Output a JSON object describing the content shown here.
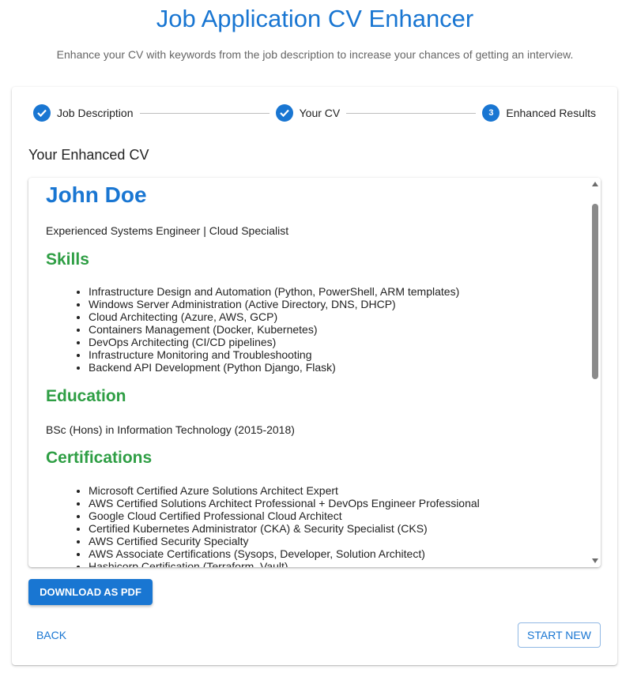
{
  "header": {
    "title": "Job Application CV Enhancer",
    "subtitle": "Enhance your CV with keywords from the job description to increase your chances of getting an interview."
  },
  "stepper": {
    "steps": [
      {
        "label": "Job Description",
        "state": "completed"
      },
      {
        "label": "Your CV",
        "state": "completed"
      },
      {
        "label": "Enhanced Results",
        "state": "active",
        "number": "3"
      }
    ]
  },
  "results": {
    "heading": "Your Enhanced CV"
  },
  "cv": {
    "name": "John Doe",
    "tagline": "Experienced Systems Engineer | Cloud Specialist",
    "skills_heading": "Skills",
    "skills": [
      "Infrastructure Design and Automation (Python, PowerShell, ARM templates)",
      "Windows Server Administration (Active Directory, DNS, DHCP)",
      "Cloud Architecting (Azure, AWS, GCP)",
      "Containers Management (Docker, Kubernetes)",
      "DevOps Architecting (CI/CD pipelines)",
      "Infrastructure Monitoring and Troubleshooting",
      "Backend API Development (Python Django, Flask)"
    ],
    "education_heading": "Education",
    "education": "BSc (Hons) in Information Technology (2015-2018)",
    "certifications_heading": "Certifications",
    "certifications": [
      "Microsoft Certified Azure Solutions Architect Expert",
      "AWS Certified Solutions Architect Professional + DevOps Engineer Professional",
      "Google Cloud Certified Professional Cloud Architect",
      "Certified Kubernetes Administrator (CKA) & Security Specialist (CKS)",
      "AWS Certified Security Specialty",
      "AWS Associate Certifications (Sysops, Developer, Solution Architect)",
      "Hashicorp Certification (Terraform, Vault)"
    ]
  },
  "actions": {
    "download_label": "DOWNLOAD AS PDF",
    "back_label": "BACK",
    "start_new_label": "START NEW"
  },
  "colors": {
    "primary": "#1976d2",
    "heading_green": "#2e9e44"
  },
  "icons": {
    "completed_step": "check-icon"
  }
}
